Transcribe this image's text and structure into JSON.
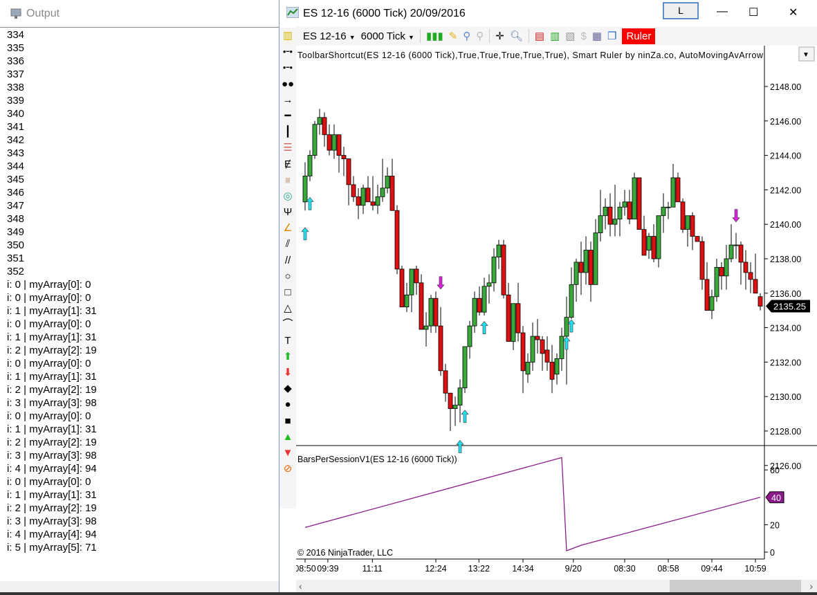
{
  "output_panel": {
    "title": "Output",
    "lines": [
      "334",
      "335",
      "336",
      "337",
      "338",
      "339",
      "340",
      "341",
      "342",
      "343",
      "344",
      "345",
      "346",
      "347",
      "348",
      "349",
      "350",
      "351",
      "352",
      "i: 0 | myArray[0]: 0",
      "i: 0 | myArray[0]: 0",
      "i: 1 | myArray[1]: 31",
      "i: 0 | myArray[0]: 0",
      "i: 1 | myArray[1]: 31",
      "i: 2 | myArray[2]: 19",
      "i: 0 | myArray[0]: 0",
      "i: 1 | myArray[1]: 31",
      "i: 2 | myArray[2]: 19",
      "i: 3 | myArray[3]: 98",
      "i: 0 | myArray[0]: 0",
      "i: 1 | myArray[1]: 31",
      "i: 2 | myArray[2]: 19",
      "i: 3 | myArray[3]: 98",
      "i: 4 | myArray[4]: 94",
      "i: 0 | myArray[0]: 0",
      "i: 1 | myArray[1]: 31",
      "i: 2 | myArray[2]: 19",
      "i: 3 | myArray[3]: 98",
      "i: 4 | myArray[4]: 94",
      "i: 5 | myArray[5]: 71"
    ]
  },
  "window": {
    "title": "ES 12-16 (6000 Tick)  20/09/2016",
    "l_button": "L",
    "minimize": "—",
    "maximize": "☐",
    "close": "✕"
  },
  "toolbar": {
    "instrument": "ES 12-16",
    "interval": "6000 Tick",
    "ruler": "Ruler",
    "ruler_color": "#ff0000"
  },
  "tools": [
    "ruler",
    "line",
    "ray",
    "extended-line",
    "arrow-line",
    "horizontal-line",
    "vertical-line",
    "fib-retracement",
    "fib-extension",
    "fib-time",
    "fib-circle",
    "andrews-pitchfork",
    "gann-fan",
    "regression-channel",
    "trend-channel",
    "ellipse",
    "rectangle",
    "triangle",
    "arc",
    "text",
    "arrow-up",
    "arrow-down",
    "diamond",
    "dot",
    "square",
    "triangle-up",
    "triangle-down",
    "remove-drawings"
  ],
  "chart_data": [
    {
      "type": "candlestick",
      "label": "ToolbarShortcut(ES  12-16  (6000  Tick),True,True,True,True,True),  Smart  Ruler  by  ninZa.co,  AutoMovingAvArrow",
      "ylim": [
        2125.2,
        2148.2
      ],
      "yticks": [
        2126,
        2128,
        2130,
        2132,
        2134,
        2136,
        2138,
        2140,
        2142,
        2144,
        2146,
        2148
      ],
      "last_price": "2135.25",
      "up_color": "#3aa83a",
      "down_color": "#dd1111",
      "ohlc": [
        [
          2141.3,
          2143.6,
          2140.8,
          2142.8
        ],
        [
          2142.8,
          2144.3,
          2142.5,
          2144.0
        ],
        [
          2144.0,
          2146.0,
          2143.8,
          2145.8
        ],
        [
          2145.8,
          2146.7,
          2145.2,
          2146.2
        ],
        [
          2146.2,
          2146.5,
          2144.5,
          2145.2
        ],
        [
          2145.2,
          2145.8,
          2144.0,
          2144.3
        ],
        [
          2144.3,
          2145.8,
          2143.8,
          2145.2
        ],
        [
          2145.2,
          2145.2,
          2143.0,
          2144.0
        ],
        [
          2144.0,
          2144.5,
          2142.8,
          2143.8
        ],
        [
          2143.8,
          2143.8,
          2141.1,
          2142.3
        ],
        [
          2142.3,
          2142.8,
          2141.3,
          2141.6
        ],
        [
          2141.6,
          2142.1,
          2140.3,
          2141.1
        ],
        [
          2141.1,
          2142.3,
          2140.6,
          2142.1
        ],
        [
          2142.1,
          2142.8,
          2141.3,
          2141.3
        ],
        [
          2141.3,
          2142.8,
          2140.8,
          2141.1
        ],
        [
          2141.1,
          2142.3,
          2140.6,
          2141.6
        ],
        [
          2141.6,
          2143.8,
          2141.3,
          2142.1
        ],
        [
          2142.1,
          2143.3,
          2141.8,
          2142.8
        ],
        [
          2142.8,
          2143.8,
          2140.8,
          2140.8
        ],
        [
          2140.8,
          2141.1,
          2137.1,
          2137.4
        ],
        [
          2137.4,
          2137.6,
          2135.2,
          2135.2
        ],
        [
          2135.2,
          2136.6,
          2134.9,
          2135.9
        ],
        [
          2135.9,
          2137.4,
          2134.9,
          2137.4
        ],
        [
          2137.4,
          2137.6,
          2135.9,
          2136.6
        ],
        [
          2136.6,
          2137.1,
          2133.9,
          2133.9
        ],
        [
          2133.9,
          2134.9,
          2132.9,
          2134.1
        ],
        [
          2134.1,
          2135.9,
          2133.7,
          2135.7
        ],
        [
          2135.7,
          2136.1,
          2133.7,
          2134.1
        ],
        [
          2134.1,
          2135.2,
          2131.2,
          2131.5
        ],
        [
          2131.5,
          2131.9,
          2129.7,
          2130.2
        ],
        [
          2130.2,
          2130.2,
          2128.0,
          2129.3
        ],
        [
          2129.3,
          2130.0,
          2128.3,
          2129.5
        ],
        [
          2129.5,
          2131.0,
          2128.5,
          2130.5
        ],
        [
          2130.5,
          2132.9,
          2130.2,
          2132.9
        ],
        [
          2132.9,
          2134.4,
          2132.2,
          2134.1
        ],
        [
          2134.1,
          2136.1,
          2133.7,
          2135.7
        ],
        [
          2135.7,
          2136.4,
          2134.7,
          2134.9
        ],
        [
          2134.9,
          2136.9,
          2134.7,
          2136.4
        ],
        [
          2136.4,
          2137.1,
          2135.4,
          2136.6
        ],
        [
          2136.6,
          2138.6,
          2136.1,
          2138.1
        ],
        [
          2138.1,
          2139.1,
          2137.4,
          2138.8
        ],
        [
          2138.8,
          2139.1,
          2135.7,
          2135.9
        ],
        [
          2135.9,
          2136.6,
          2133.2,
          2133.2
        ],
        [
          2133.2,
          2135.4,
          2132.7,
          2135.4
        ],
        [
          2135.4,
          2136.6,
          2133.2,
          2133.7
        ],
        [
          2133.7,
          2134.1,
          2130.2,
          2131.5
        ],
        [
          2131.3,
          2132.5,
          2130.8,
          2132.0
        ],
        [
          2132.0,
          2134.3,
          2131.5,
          2133.5
        ],
        [
          2133.5,
          2134.5,
          2132.5,
          2133.3
        ],
        [
          2133.3,
          2133.5,
          2131.5,
          2132.5
        ],
        [
          2132.7,
          2133.5,
          2131.5,
          2132.0
        ],
        [
          2132.0,
          2133.0,
          2130.2,
          2131.0
        ],
        [
          2131.3,
          2132.5,
          2130.7,
          2132.2
        ],
        [
          2132.2,
          2134.0,
          2131.5,
          2133.5
        ],
        [
          2133.5,
          2135.8,
          2130.7,
          2134.6
        ],
        [
          2134.6,
          2137.5,
          2134.5,
          2136.5
        ],
        [
          2136.5,
          2138.0,
          2135.5,
          2137.8
        ],
        [
          2137.8,
          2139.0,
          2135.9,
          2137.2
        ],
        [
          2137.2,
          2139.3,
          2136.5,
          2138.5
        ],
        [
          2138.5,
          2139.0,
          2135.5,
          2136.5
        ],
        [
          2136.5,
          2140.3,
          2136.5,
          2139.5
        ],
        [
          2139.5,
          2142.0,
          2139.0,
          2140.5
        ],
        [
          2140.5,
          2141.5,
          2139.7,
          2141.0
        ],
        [
          2141.0,
          2141.8,
          2139.3,
          2140.0
        ],
        [
          2140.0,
          2142.3,
          2139.3,
          2140.3
        ],
        [
          2140.3,
          2141.3,
          2139.3,
          2141.0
        ],
        [
          2141.0,
          2142.0,
          2140.5,
          2141.3
        ],
        [
          2141.3,
          2142.0,
          2140.0,
          2140.3
        ],
        [
          2140.3,
          2143.0,
          2140.3,
          2142.7
        ],
        [
          2142.7,
          2142.7,
          2139.7,
          2139.7
        ],
        [
          2139.7,
          2140.5,
          2138.2,
          2138.2
        ],
        [
          2138.5,
          2139.5,
          2138.0,
          2139.3
        ],
        [
          2139.3,
          2140.0,
          2137.8,
          2138.0
        ],
        [
          2138.0,
          2140.5,
          2137.5,
          2140.5
        ],
        [
          2140.5,
          2141.8,
          2139.5,
          2141.0
        ],
        [
          2141.0,
          2141.3,
          2140.3,
          2141.0
        ],
        [
          2141.0,
          2143.5,
          2141.0,
          2142.7
        ],
        [
          2142.7,
          2143.0,
          2141.3,
          2141.3
        ],
        [
          2141.3,
          2141.5,
          2139.5,
          2139.7
        ],
        [
          2139.7,
          2140.5,
          2138.7,
          2140.5
        ],
        [
          2140.5,
          2140.7,
          2138.5,
          2139.3
        ],
        [
          2139.3,
          2139.3,
          2139.0,
          2139.0
        ],
        [
          2139.0,
          2139.3,
          2136.2,
          2136.8
        ],
        [
          2136.8,
          2137.8,
          2135.0,
          2135.0
        ],
        [
          2135.0,
          2136.2,
          2134.5,
          2135.8
        ],
        [
          2135.8,
          2138.0,
          2135.5,
          2137.5
        ],
        [
          2137.5,
          2137.8,
          2136.2,
          2137.0
        ],
        [
          2137.0,
          2138.8,
          2136.2,
          2138.0
        ],
        [
          2138.0,
          2140.0,
          2137.8,
          2138.8
        ],
        [
          2138.8,
          2139.5,
          2138.0,
          2138.8
        ],
        [
          2138.8,
          2139.0,
          2136.5,
          2137.8
        ],
        [
          2137.8,
          2138.5,
          2136.2,
          2137.2
        ],
        [
          2137.2,
          2137.8,
          2136.0,
          2136.8
        ],
        [
          2136.8,
          2138.3,
          2136.0,
          2136.0
        ],
        [
          2135.8,
          2136.0,
          2135.0,
          2135.25
        ]
      ],
      "arrows": [
        {
          "bar": 2,
          "dir": "up",
          "price": 2141.2
        },
        {
          "bar": 1,
          "dir": "up",
          "price": 2139.45
        },
        {
          "bar": 29,
          "dir": "down",
          "price": 2136.6
        },
        {
          "bar": 38,
          "dir": "up",
          "price": 2134.0
        },
        {
          "bar": 34,
          "dir": "up",
          "price": 2128.85
        },
        {
          "bar": 33,
          "dir": "up",
          "price": 2127.1
        },
        {
          "bar": 56,
          "dir": "up",
          "price": 2134.1
        },
        {
          "bar": 55,
          "dir": "up",
          "price": 2133.1
        },
        {
          "bar": 90,
          "dir": "down",
          "price": 2140.5
        }
      ],
      "arrow_up_color": "#22e0f0",
      "arrow_down_color": "#dd22dd"
    },
    {
      "type": "line",
      "label": "BarsPerSessionV1(ES 12-16 (6000 Tick))",
      "ylim": [
        -3,
        75
      ],
      "yticks": [
        0,
        20,
        60
      ],
      "last_value": "40",
      "color": "#8b1a8b",
      "points": [
        {
          "bar": 1,
          "value": 18
        },
        {
          "bar": 54,
          "value": 69
        },
        {
          "bar": 55,
          "value": 1
        },
        {
          "bar": 58,
          "value": 5
        },
        {
          "bar": 95,
          "value": 40
        }
      ]
    }
  ],
  "xaxis": {
    "ticks": [
      {
        "label": "08:50",
        "bar": 1
      },
      {
        "label": "09:39",
        "bar": 5.7
      },
      {
        "label": "11:11",
        "bar": 14.9
      },
      {
        "label": "12:24",
        "bar": 28
      },
      {
        "label": "13:22",
        "bar": 36.9
      },
      {
        "label": "14:34",
        "bar": 46
      },
      {
        "label": "9/20",
        "bar": 56.4
      },
      {
        "label": "08:30",
        "bar": 67
      },
      {
        "label": "08:58",
        "bar": 76
      },
      {
        "label": "09:44",
        "bar": 85
      },
      {
        "label": "10:59",
        "bar": 94
      }
    ]
  },
  "copyright": "© 2016 NinjaTrader, LLC"
}
